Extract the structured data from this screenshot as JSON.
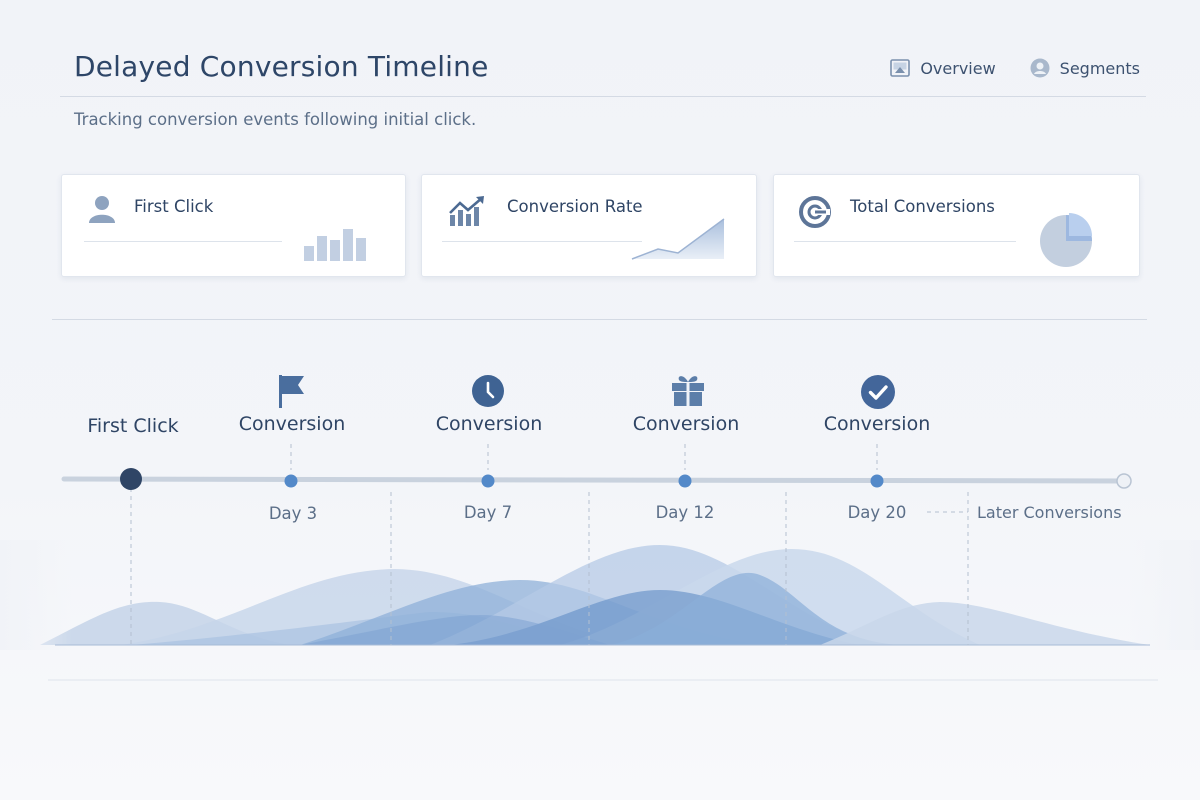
{
  "header": {
    "title": "Delayed Conversion Timeline",
    "subtitle": "Tracking conversion events following initial click.",
    "nav": [
      {
        "label": "Overview",
        "icon": "image-icon"
      },
      {
        "label": "Segments",
        "icon": "user-icon"
      }
    ]
  },
  "cards": [
    {
      "title": "First Click",
      "icon": "user-icon",
      "mini_chart": "bar-chart",
      "mini_values": [
        0.4,
        0.65,
        0.55,
        0.85,
        0.6
      ]
    },
    {
      "title": "Conversion Rate",
      "icon": "trending-up-icon",
      "mini_chart": "area-chart"
    },
    {
      "title": "Total Conversions",
      "icon": "ring-icon",
      "mini_chart": "pie-chart"
    }
  ],
  "timeline": {
    "start": {
      "label": "First Click"
    },
    "milestones": [
      {
        "label": "Conversion",
        "day": "Day 3",
        "icon": "flag-icon"
      },
      {
        "label": "Conversion",
        "day": "Day 7",
        "icon": "clock-icon"
      },
      {
        "label": "Conversion",
        "day": "Day 12",
        "icon": "gift-icon"
      },
      {
        "label": "Conversion",
        "day": "Day 20",
        "icon": "check-circle-icon"
      }
    ],
    "end": {
      "label": "Later Conversions"
    }
  },
  "colors": {
    "accent": "#4f7fb8",
    "dark_node": "#2f4566",
    "track": "#c9d2de",
    "wave_light": "#b9cbe4",
    "wave_mid": "#8fb0d8",
    "wave_dark": "#5a87c0"
  }
}
